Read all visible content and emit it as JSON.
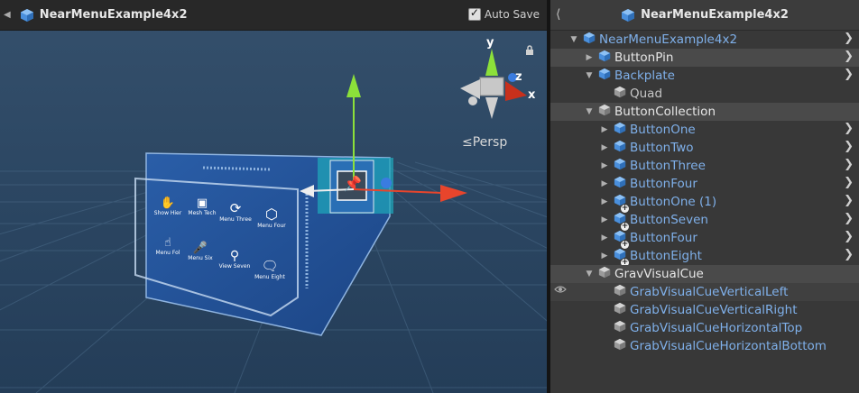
{
  "scene": {
    "title": "NearMenuExample4x2",
    "autosave_label": "Auto Save",
    "autosave_checked": true,
    "persp_label": "≤Persp",
    "gizmo_axes": {
      "x": "x",
      "y": "y",
      "z": "z"
    },
    "menu_buttons": [
      {
        "label": "Show Hier",
        "icon": "hand-icon"
      },
      {
        "label": "Mesh Tech",
        "icon": "camera-icon"
      },
      {
        "label": "Menu Three",
        "icon": "refresh-icon"
      },
      {
        "label": "Menu Four",
        "icon": "cube-icon"
      },
      {
        "label": "Menu Fol",
        "icon": "touch-icon"
      },
      {
        "label": "Menu Six",
        "icon": "mic-icon"
      },
      {
        "label": "View Seven",
        "icon": "search-icon"
      },
      {
        "label": "Menu Eight",
        "icon": "chat-icon"
      }
    ],
    "colors": {
      "axis_x": "#e8452c",
      "axis_y": "#8ce03a",
      "axis_z": "#3a7ce0",
      "panel": "#1f4f92"
    }
  },
  "hierarchy": {
    "title": "NearMenuExample4x2",
    "back_icon": "chevron-left-icon",
    "items": [
      {
        "label": "NearMenuExample4x2",
        "type": "prefab",
        "arrow": "down",
        "chevron": true
      },
      {
        "label": "ButtonPin",
        "type": "prefab",
        "arrow": "right",
        "chevron": true,
        "selected": true
      },
      {
        "label": "Backplate",
        "type": "prefab",
        "arrow": "down",
        "chevron": true
      },
      {
        "label": "Quad",
        "type": "object",
        "arrow": "",
        "chevron": false
      },
      {
        "label": "ButtonCollection",
        "type": "object",
        "arrow": "down",
        "chevron": false,
        "selected": true
      },
      {
        "label": "ButtonOne",
        "type": "prefab",
        "arrow": "right",
        "chevron": true
      },
      {
        "label": "ButtonTwo",
        "type": "prefab",
        "arrow": "right",
        "chevron": true
      },
      {
        "label": "ButtonThree",
        "type": "prefab",
        "arrow": "right",
        "chevron": true
      },
      {
        "label": "ButtonFour",
        "type": "prefab",
        "arrow": "right",
        "chevron": true
      },
      {
        "label": "ButtonOne (1)",
        "type": "prefab-added",
        "arrow": "right",
        "chevron": true
      },
      {
        "label": "ButtonSeven",
        "type": "prefab-added",
        "arrow": "right",
        "chevron": true
      },
      {
        "label": "ButtonFour",
        "type": "prefab-added",
        "arrow": "right",
        "chevron": true
      },
      {
        "label": "ButtonEight",
        "type": "prefab-added",
        "arrow": "right",
        "chevron": true
      },
      {
        "label": "GravVisualCue",
        "type": "object",
        "arrow": "down",
        "chevron": false,
        "selected": true
      },
      {
        "label": "GrabVisualCueVerticalLeft",
        "type": "object-prefab",
        "arrow": "",
        "chevron": false,
        "dim": true
      },
      {
        "label": "GrabVisualCueVerticalRight",
        "type": "object-prefab",
        "arrow": "",
        "chevron": false
      },
      {
        "label": "GrabVisualCueHorizontalTop",
        "type": "object-prefab",
        "arrow": "",
        "chevron": false
      },
      {
        "label": "GrabVisualCueHorizontalBottom",
        "type": "object-prefab",
        "arrow": "",
        "chevron": false
      }
    ]
  }
}
